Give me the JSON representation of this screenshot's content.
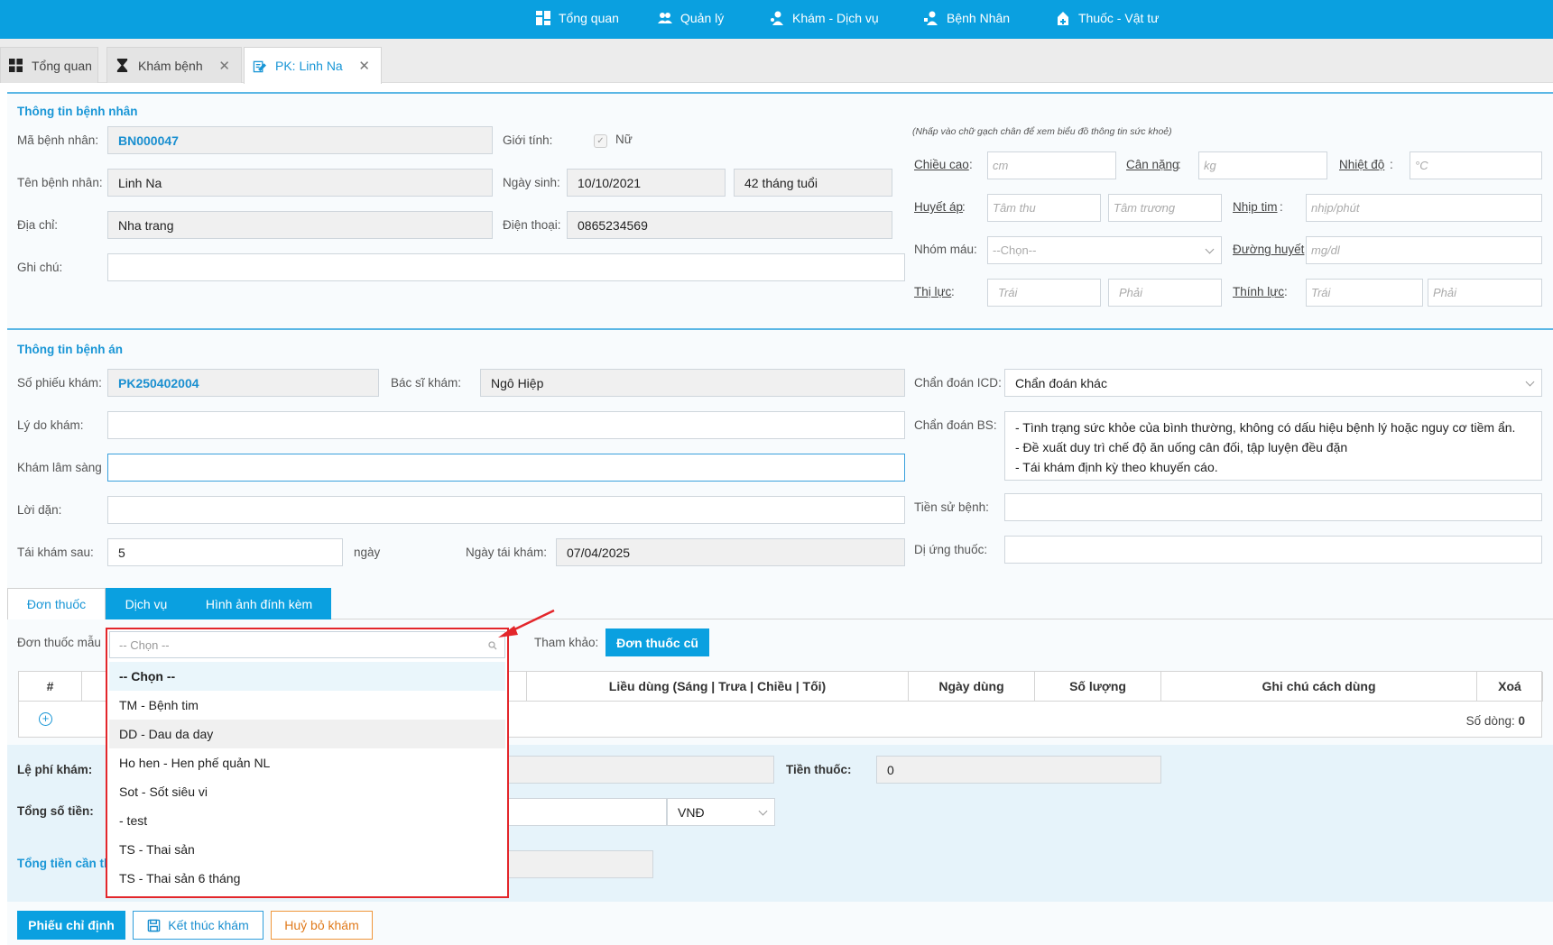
{
  "topnav": {
    "items": [
      {
        "label": "Tổng quan",
        "icon": "dashboard-icon"
      },
      {
        "label": "Quản lý",
        "icon": "users-icon"
      },
      {
        "label": "Khám - Dịch vụ",
        "icon": "doctor-icon"
      },
      {
        "label": "Bệnh Nhân",
        "icon": "patient-icon"
      },
      {
        "label": "Thuốc - Vật tư",
        "icon": "pharmacy-icon"
      }
    ]
  },
  "tabs": [
    {
      "label": "Tổng quan"
    },
    {
      "label": "Khám bệnh"
    },
    {
      "label": "PK: Linh Na"
    }
  ],
  "patient": {
    "section_title": "Thông tin bệnh nhân",
    "id_label": "Mã bệnh nhân",
    "id_value": "BN000047",
    "gender_label": "Giới tính",
    "gender_value": "Nữ",
    "name_label": "Tên bệnh nhân",
    "name_value": "Linh Na",
    "dob_label": "Ngày sinh",
    "dob_value": "10/10/2021",
    "age_value": "42 tháng tuổi",
    "address_label": "Địa chỉ",
    "address_value": "Nha trang",
    "phone_label": "Điện thoại",
    "phone_value": "0865234569",
    "note_label": "Ghi chú",
    "note_value": ""
  },
  "vitals": {
    "hint": "(Nhấp vào chữ gạch chân để xem biểu đồ thông tin sức khoẻ)",
    "height_label": "Chiều cao",
    "height_ph": "cm",
    "weight_label": "Cân nặng",
    "weight_ph": "kg",
    "temp_label": "Nhiệt độ",
    "temp_ph": "°C",
    "bp_label": "Huyết áp",
    "bp_sys_ph": "Tâm thu",
    "bp_dia_ph": "Tâm trương",
    "hr_label": "Nhịp tim",
    "hr_ph": "nhịp/phút",
    "blood_label": "Nhóm máu",
    "blood_value": "--Chọn--",
    "glucose_label": "Đường huyết",
    "glucose_ph": "mg/dl",
    "vision_label": "Thị lực",
    "vision_left_ph": "Trái",
    "vision_right_ph": "Phải",
    "hearing_label": "Thính lực",
    "hearing_left_ph": "Trái",
    "hearing_right_ph": "Phải"
  },
  "record": {
    "section_title": "Thông tin bệnh án",
    "slip_label": "Số phiếu khám",
    "slip_value": "PK250402004",
    "doctor_label": "Bác sĩ khám",
    "doctor_value": "Ngô Hiệp",
    "icd_label": "Chẩn đoán ICD",
    "icd_value": "Chẩn đoán khác",
    "reason_label": "Lý do khám",
    "clinical_label": "Khám lâm sàng",
    "diag_label": "Chẩn đoán BS",
    "diag_lines": [
      "- Tình trạng sức khỏe của bình thường, không có dấu hiệu bệnh lý hoặc nguy cơ tiềm ẩn.",
      "- Đề xuất duy trì chế độ ăn uống cân đối, tập luyện đều đặn",
      "- Tái khám định kỳ theo khuyến cáo."
    ],
    "advice_label": "Lời dặn",
    "history_label": "Tiền sử bệnh",
    "revisit_label": "Tái khám sau",
    "revisit_value": "5",
    "revisit_unit": "ngày",
    "revisit_date_label": "Ngày tái khám",
    "revisit_date_value": "07/04/2025",
    "allergy_label": "Dị ứng thuốc"
  },
  "med_tabs": [
    "Đơn thuốc",
    "Dịch vụ",
    "Hình ảnh đính kèm"
  ],
  "prescription": {
    "template_label": "Đơn thuốc mẫu",
    "ref_label": "Tham khảo:",
    "old_btn": "Đơn thuốc cũ",
    "columns": [
      "#",
      "",
      "",
      "Liều dùng (Sáng | Trưa | Chiều | Tối)",
      "Ngày dùng",
      "Số lượng",
      "Ghi chú cách dùng",
      "Xoá"
    ],
    "row_count_label": "Số dòng:",
    "row_count_value": "0"
  },
  "fees": {
    "exam_fee_label": "Lệ phí khám",
    "med_fee_label": "Tiền thuốc",
    "med_fee_value": "0",
    "total_label": "Tổng số tiền",
    "currency": "VNĐ",
    "total_due_label": "Tổng tiền cần th"
  },
  "actions": {
    "order_btn": "Phiếu chỉ định",
    "finish_btn": "Kết thúc khám",
    "cancel_btn": "Huỷ bỏ khám"
  },
  "dropdown": {
    "placeholder": "-- Chọn --",
    "options": [
      "-- Chọn --",
      "TM - Bệnh tim",
      "DD - Dau da day",
      "Ho hen - Hen phế quản NL",
      "Sot - Sốt siêu vi",
      "- test",
      "TS - Thai sản",
      "TS - Thai sản 6 tháng"
    ]
  },
  "colors": {
    "brand": "#0aa0e0",
    "accent_text": "#1996d6",
    "highlight": "#e3262b"
  }
}
